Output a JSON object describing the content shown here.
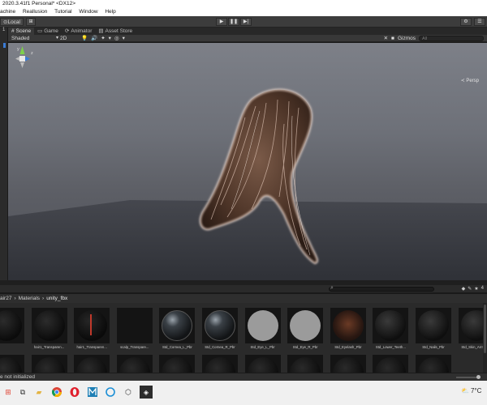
{
  "window": {
    "title": "2020.3.41f1 Personal* <DX12>"
  },
  "menu": [
    "achine",
    "Reallusion",
    "Tutorial",
    "Window",
    "Help"
  ],
  "toolbar": {
    "pivot_label": "Local",
    "grid_icon": "grid-snap-icon",
    "play_icon": "▶",
    "pause_icon": "❚❚",
    "step_icon": "▶|",
    "right_icons": [
      "⚙",
      "☰"
    ]
  },
  "left_strip": {
    "label": "1"
  },
  "tabs": [
    {
      "icon": "#",
      "label": "Scene"
    },
    {
      "icon": "▭",
      "label": "Game"
    },
    {
      "icon": "⟳",
      "label": "Animator"
    },
    {
      "icon": "▤",
      "label": "Asset Store"
    }
  ],
  "scene_toolbar": {
    "shading_mode": "Shaded",
    "mode_2d": "2D",
    "icons": [
      "💡",
      "🔊",
      "✦",
      "▾",
      "◎",
      "▾"
    ],
    "right": {
      "tools_icon": "✕",
      "camera_icon": "■",
      "gizmos_label": "Gizmos",
      "search_placeholder": "All"
    },
    "perspective_label": "Persp"
  },
  "gizmo": {
    "y_label": "y",
    "z_label": "z"
  },
  "project": {
    "breadcrumb": [
      "air27",
      "Materials",
      "unity_fbx"
    ],
    "search_placeholder": "",
    "icons": [
      "◆",
      "✎",
      "★",
      "4"
    ]
  },
  "assets": [
    {
      "label": "",
      "kind": "dark-sphere"
    },
    {
      "label": "hair1_Transparen...",
      "kind": "dark-sphere"
    },
    {
      "label": "hair1_Transparen...",
      "kind": "red-line"
    },
    {
      "label": "scalp_Transpare...",
      "kind": "black"
    },
    {
      "label": "Std_Cornea_L_Pbr",
      "kind": "glass-sphere"
    },
    {
      "label": "Std_Cornea_R_Pbr",
      "kind": "glass-sphere"
    },
    {
      "label": "Std_Eye_L_Pbr",
      "kind": "gray-sphere"
    },
    {
      "label": "Std_Eye_R_Pbr",
      "kind": "gray-sphere"
    },
    {
      "label": "Std_Eyelash_Pbr",
      "kind": "eyelash"
    },
    {
      "label": "Std_Lower_Teeth...",
      "kind": "dark-drop"
    },
    {
      "label": "Std_Nails_Pbr",
      "kind": "dark-drop"
    },
    {
      "label": "Std_Skin_Arm_Pbr",
      "kind": "dark-drop"
    },
    {
      "label": "",
      "kind": "dark-drop"
    }
  ],
  "status": {
    "message": "e not initialized"
  },
  "taskbar": {
    "icons": [
      "windows-icon",
      "task-view-icon",
      "file-explorer-icon",
      "chrome-icon",
      "opera-icon",
      "media-icon",
      "cortana-icon",
      "unity-icon",
      "unity-hub-icon"
    ],
    "weather": "7°C"
  },
  "colors": {
    "accent": "#3a7bd5",
    "panel": "#2a2a2a",
    "viewport_top": "#7d8088",
    "floor": "#3a3c43"
  }
}
